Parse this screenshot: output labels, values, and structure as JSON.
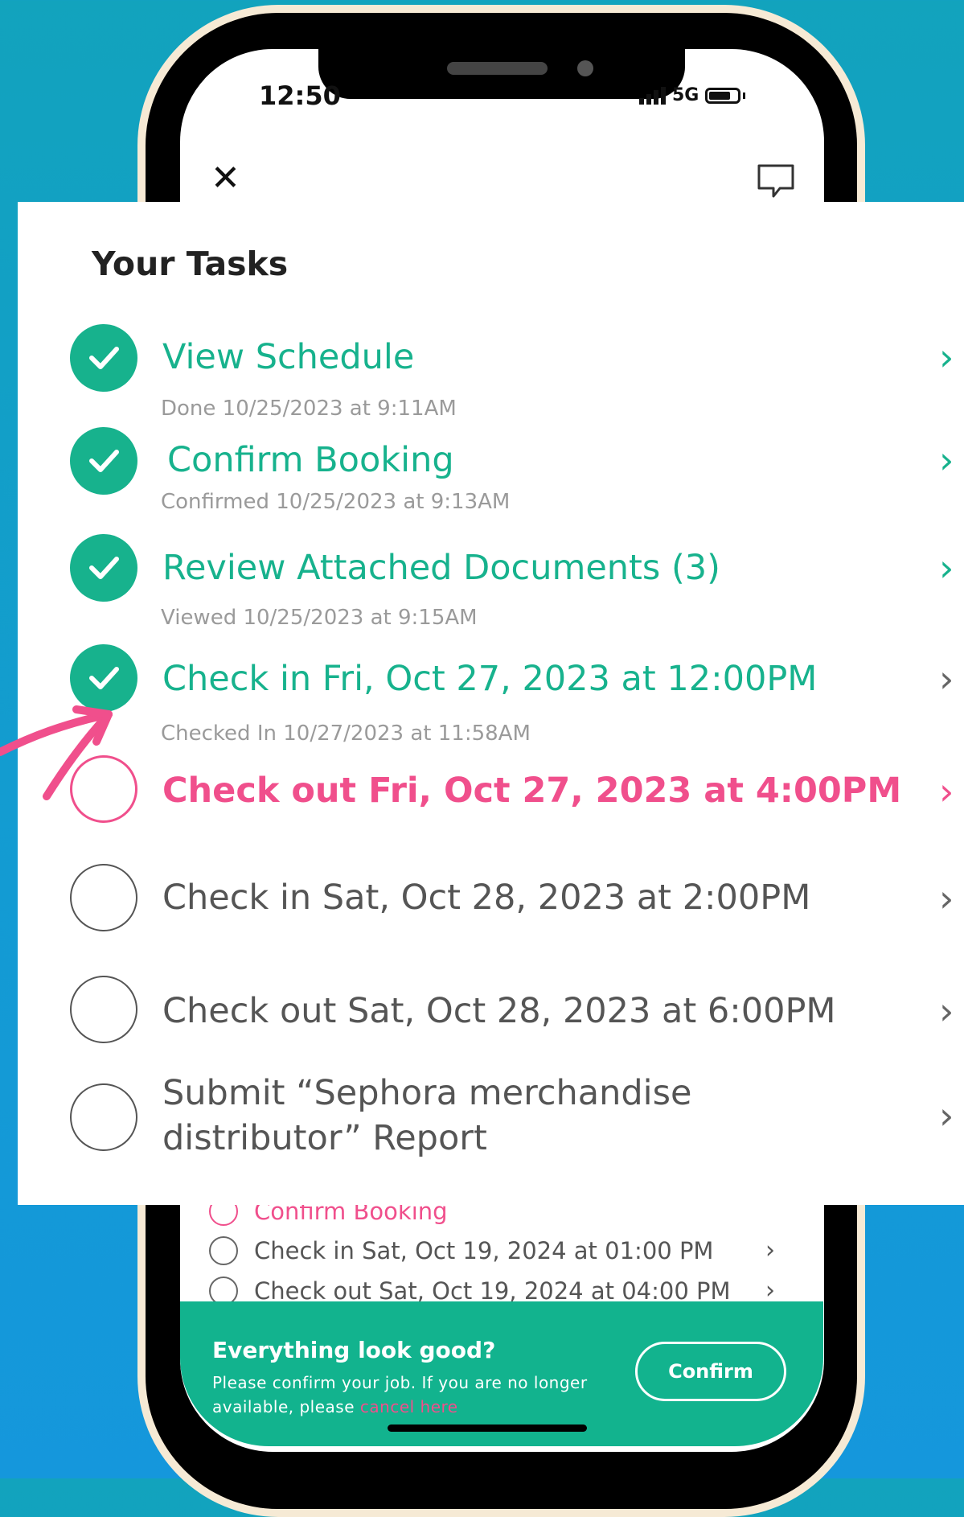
{
  "status_bar": {
    "time": "12:50",
    "network": "5G"
  },
  "header": {
    "close_icon": "close-icon",
    "chat_icon": "chat-bubble-icon"
  },
  "background_list": {
    "items": [
      {
        "label": "Confirm Booking"
      },
      {
        "label": "Check in Sat, Oct 19, 2024 at 01:00 PM"
      },
      {
        "label": "Check out Sat, Oct 19, 2024 at 04:00 PM"
      }
    ]
  },
  "confirm_bar": {
    "title": "Everything look good?",
    "text_before": "Please confirm your job. If you are no longer available, please ",
    "link": "cancel here",
    "button": "Confirm"
  },
  "tasks_card": {
    "title": "Your Tasks",
    "tasks": [
      {
        "label": "View Schedule",
        "sub": "Done 10/25/2023 at 9:11AM",
        "state": "done"
      },
      {
        "label": "Confirm Booking",
        "sub": "Confirmed 10/25/2023 at 9:13AM",
        "state": "done"
      },
      {
        "label": "Review Attached Documents (3)",
        "sub": "Viewed 10/25/2023 at 9:15AM",
        "state": "done"
      },
      {
        "label": "Check in Fri, Oct 27, 2023 at 12:00PM",
        "sub": "Checked In 10/27/2023 at 11:58AM",
        "state": "done"
      },
      {
        "label": "Check out Fri, Oct 27, 2023 at 4:00PM",
        "state": "active"
      },
      {
        "label": "Check in Sat, Oct 28, 2023 at 2:00PM",
        "state": "pending"
      },
      {
        "label": "Check out Sat, Oct 28, 2023 at 6:00PM",
        "state": "pending"
      },
      {
        "label_line1": "Submit “Sephora merchandise",
        "label_line2": "distributor” Report",
        "state": "pending"
      }
    ]
  },
  "colors": {
    "accent_green": "#17b28d",
    "accent_pink": "#f04f8c",
    "background": "#139bd3"
  }
}
